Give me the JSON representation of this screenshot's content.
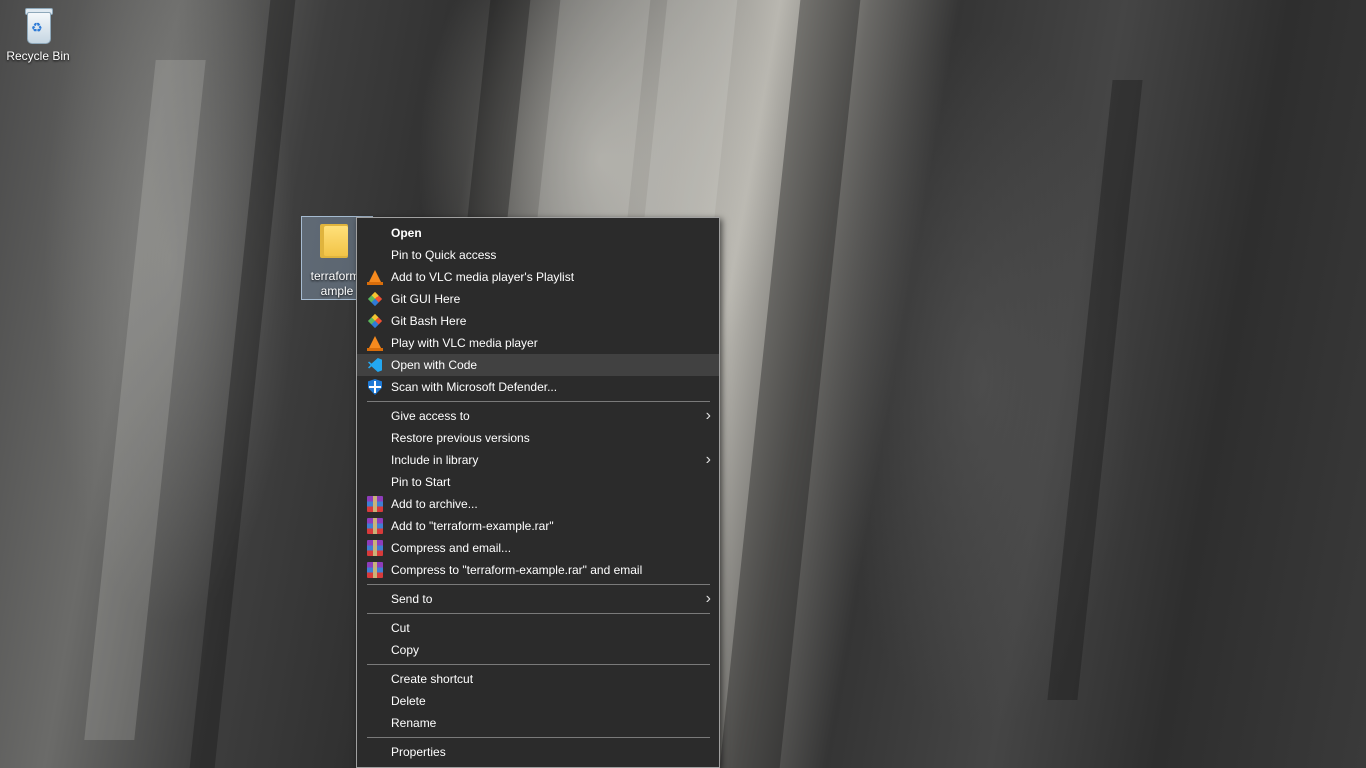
{
  "desktop": {
    "icons": [
      {
        "label": "Recycle Bin"
      },
      {
        "label": "terraform-example",
        "label_line1": "terraform-",
        "label_line2": "ample"
      }
    ]
  },
  "context_menu": {
    "groups": [
      [
        {
          "label": "Open",
          "bold": true
        },
        {
          "label": "Pin to Quick access"
        },
        {
          "label": "Add to VLC media player's Playlist",
          "icon": "vlc-icon"
        },
        {
          "label": "Git GUI Here",
          "icon": "git-icon"
        },
        {
          "label": "Git Bash Here",
          "icon": "git-icon"
        },
        {
          "label": "Play with VLC media player",
          "icon": "vlc-icon"
        },
        {
          "label": "Open with Code",
          "icon": "vscode-icon",
          "hovered": true
        },
        {
          "label": "Scan with Microsoft Defender...",
          "icon": "defender-icon"
        }
      ],
      [
        {
          "label": "Give access to",
          "submenu": true
        },
        {
          "label": "Restore previous versions"
        },
        {
          "label": "Include in library",
          "submenu": true
        },
        {
          "label": "Pin to Start"
        },
        {
          "label": "Add to archive...",
          "icon": "winrar-icon"
        },
        {
          "label": "Add to \"terraform-example.rar\"",
          "icon": "winrar-icon"
        },
        {
          "label": "Compress and email...",
          "icon": "winrar-icon"
        },
        {
          "label": "Compress to \"terraform-example.rar\" and email",
          "icon": "winrar-icon"
        }
      ],
      [
        {
          "label": "Send to",
          "submenu": true
        }
      ],
      [
        {
          "label": "Cut"
        },
        {
          "label": "Copy"
        }
      ],
      [
        {
          "label": "Create shortcut"
        },
        {
          "label": "Delete"
        },
        {
          "label": "Rename"
        }
      ],
      [
        {
          "label": "Properties"
        }
      ]
    ]
  },
  "colors": {
    "menu_bg": "#2b2b2b",
    "menu_hover": "#414141",
    "menu_border": "#a0a0a0",
    "selection": "#a0bedc"
  }
}
